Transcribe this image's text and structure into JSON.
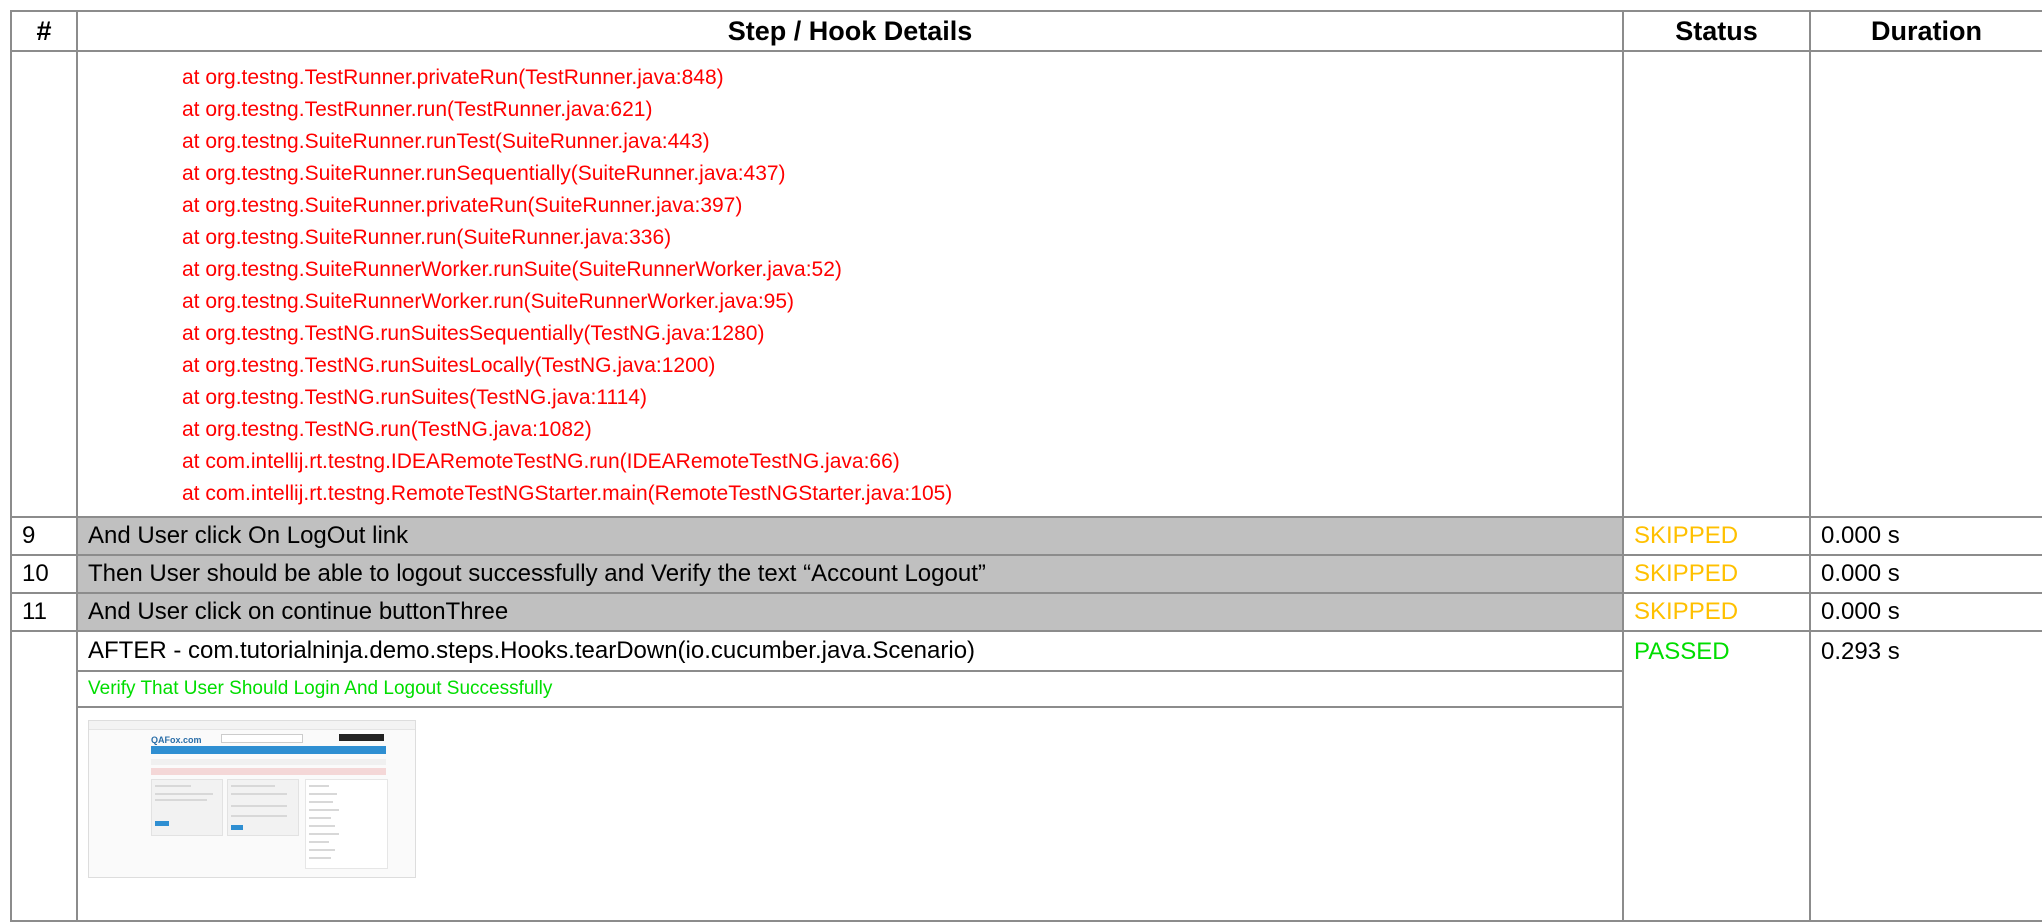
{
  "headers": {
    "num": "#",
    "details": "Step / Hook Details",
    "status": "Status",
    "duration": "Duration"
  },
  "stacktrace": [
    "at org.testng.TestRunner.privateRun(TestRunner.java:848)",
    "at org.testng.TestRunner.run(TestRunner.java:621)",
    "at org.testng.SuiteRunner.runTest(SuiteRunner.java:443)",
    "at org.testng.SuiteRunner.runSequentially(SuiteRunner.java:437)",
    "at org.testng.SuiteRunner.privateRun(SuiteRunner.java:397)",
    "at org.testng.SuiteRunner.run(SuiteRunner.java:336)",
    "at org.testng.SuiteRunnerWorker.runSuite(SuiteRunnerWorker.java:52)",
    "at org.testng.SuiteRunnerWorker.run(SuiteRunnerWorker.java:95)",
    "at org.testng.TestNG.runSuitesSequentially(TestNG.java:1280)",
    "at org.testng.TestNG.runSuitesLocally(TestNG.java:1200)",
    "at org.testng.TestNG.runSuites(TestNG.java:1114)",
    "at org.testng.TestNG.run(TestNG.java:1082)",
    "at com.intellij.rt.testng.IDEARemoteTestNG.run(IDEARemoteTestNG.java:66)",
    "at com.intellij.rt.testng.RemoteTestNGStarter.main(RemoteTestNGStarter.java:105)"
  ],
  "steps": [
    {
      "num": "9",
      "text": "And User click On LogOut link",
      "status": "SKIPPED",
      "duration": "0.000 s"
    },
    {
      "num": "10",
      "text": "Then User should be able to logout successfully and Verify the text “Account Logout”",
      "status": "SKIPPED",
      "duration": "0.000 s"
    },
    {
      "num": "11",
      "text": "And User click on continue buttonThree",
      "status": "SKIPPED",
      "duration": "0.000 s"
    }
  ],
  "hook": {
    "title": "AFTER - com.tutorialninja.demo.steps.Hooks.tearDown(io.cucumber.java.Scenario)",
    "status": "PASSED",
    "duration": "0.293 s",
    "scenario": "Verify That User Should Login And Logout Successfully",
    "screenshot": {
      "logo": "QAFox.com"
    }
  },
  "colors": {
    "error": "#ff0000",
    "skipped": "#ffc000",
    "passed": "#00dd00",
    "step_bg": "#c0c0c0",
    "border": "#8c8c8c"
  }
}
